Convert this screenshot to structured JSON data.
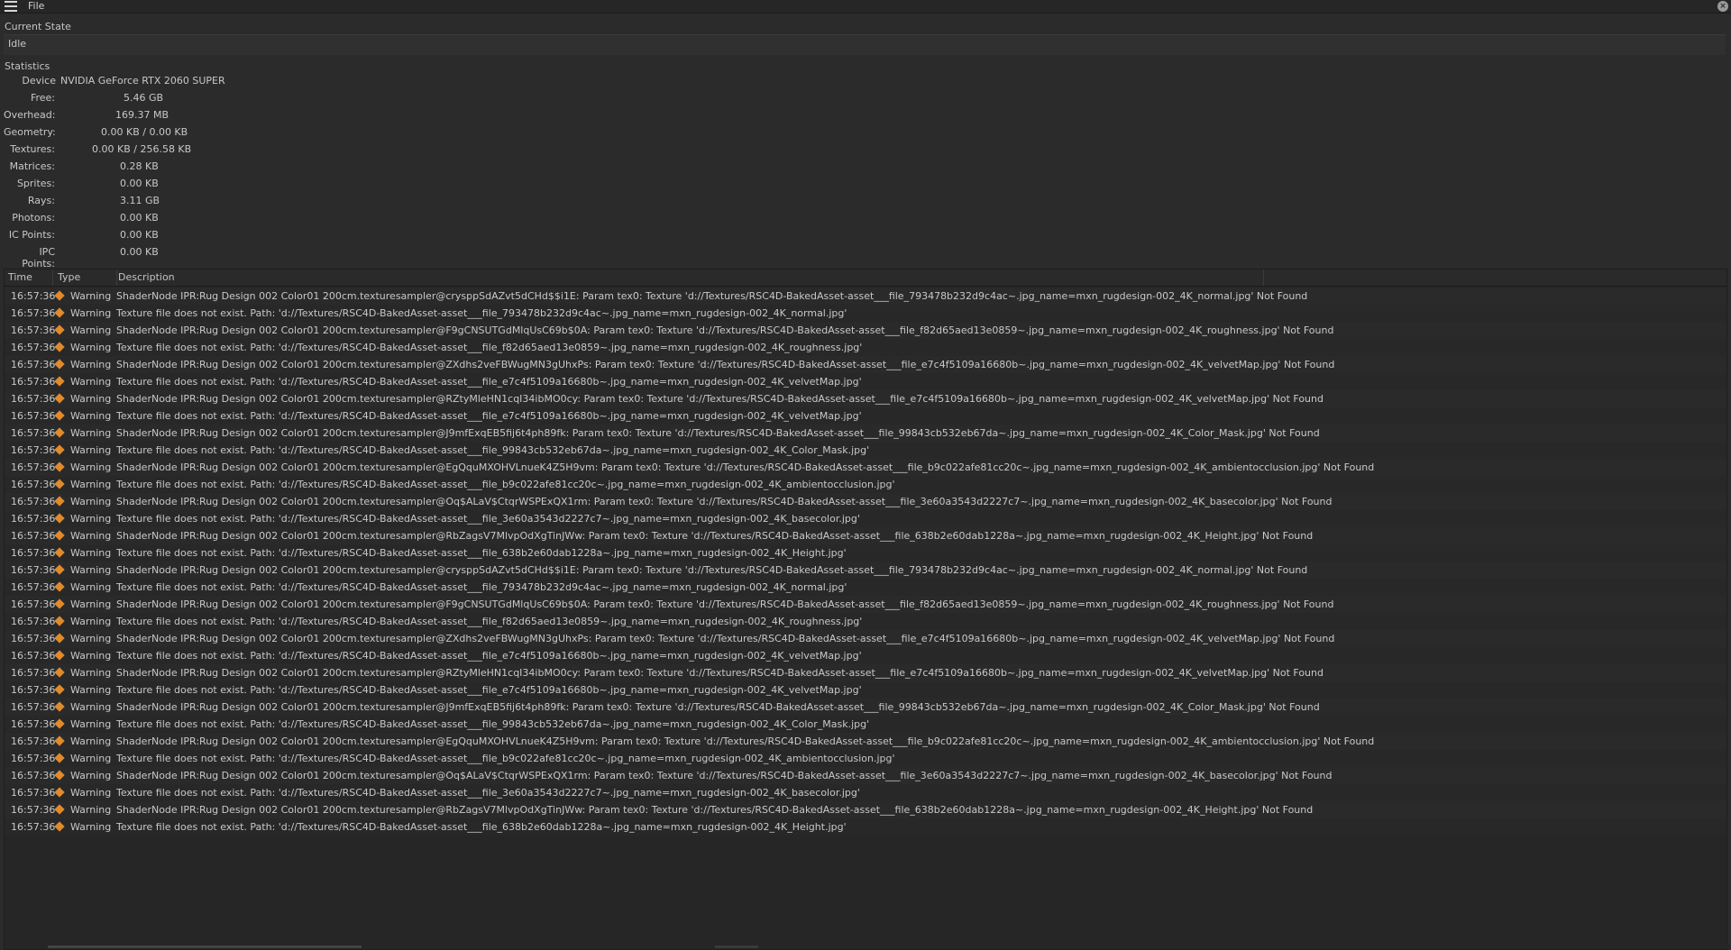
{
  "menu": {
    "file_label": "File"
  },
  "current_state": {
    "title": "Current State",
    "value": "Idle"
  },
  "statistics": {
    "title": "Statistics",
    "device_label": "Device",
    "device_value": "NVIDIA GeForce RTX 2060 SUPER",
    "rows": [
      {
        "label": "Free:",
        "value": "5.46 GB"
      },
      {
        "label": "Overhead:",
        "value": "169.37 MB"
      },
      {
        "label": "Geometry:",
        "value": "0.00 KB / 0.00 KB"
      },
      {
        "label": "Textures:",
        "value": "0.00 KB / 256.58 KB"
      },
      {
        "label": "Matrices:",
        "value": "0.28 KB"
      },
      {
        "label": "Sprites:",
        "value": "0.00 KB"
      },
      {
        "label": "Rays:",
        "value": "3.11 GB"
      },
      {
        "label": "Photons:",
        "value": "0.00 KB"
      },
      {
        "label": "IC Points:",
        "value": "0.00 KB"
      },
      {
        "label": "IPC Points:",
        "value": "0.00 KB"
      }
    ]
  },
  "log": {
    "columns": {
      "time": "Time",
      "type": "Type",
      "description": "Description"
    },
    "warning_color": "#e08a2c",
    "rows": [
      {
        "time": "16:57:36",
        "type": "Warning",
        "description": "ShaderNode IPR:Rug Design 002 Color01 200cm.texturesampler@crysppSdAZvt5dCHd$$i1E: Param tex0: Texture 'd://Textures/RSC4D-BakedAsset-asset___file_793478b232d9c4ac~.jpg_name=mxn_rugdesign-002_4K_normal.jpg' Not Found"
      },
      {
        "time": "16:57:36",
        "type": "Warning",
        "description": "Texture file does not exist. Path: 'd://Textures/RSC4D-BakedAsset-asset___file_793478b232d9c4ac~.jpg_name=mxn_rugdesign-002_4K_normal.jpg'"
      },
      {
        "time": "16:57:36",
        "type": "Warning",
        "description": "ShaderNode IPR:Rug Design 002 Color01 200cm.texturesampler@F9gCNSUTGdMlqUsC69b$0A: Param tex0: Texture 'd://Textures/RSC4D-BakedAsset-asset___file_f82d65aed13e0859~.jpg_name=mxn_rugdesign-002_4K_roughness.jpg' Not Found"
      },
      {
        "time": "16:57:36",
        "type": "Warning",
        "description": "Texture file does not exist. Path: 'd://Textures/RSC4D-BakedAsset-asset___file_f82d65aed13e0859~.jpg_name=mxn_rugdesign-002_4K_roughness.jpg'"
      },
      {
        "time": "16:57:36",
        "type": "Warning",
        "description": "ShaderNode IPR:Rug Design 002 Color01 200cm.texturesampler@ZXdhs2veFBWugMN3gUhxPs: Param tex0: Texture 'd://Textures/RSC4D-BakedAsset-asset___file_e7c4f5109a16680b~.jpg_name=mxn_rugdesign-002_4K_velvetMap.jpg' Not Found"
      },
      {
        "time": "16:57:36",
        "type": "Warning",
        "description": "Texture file does not exist. Path: 'd://Textures/RSC4D-BakedAsset-asset___file_e7c4f5109a16680b~.jpg_name=mxn_rugdesign-002_4K_velvetMap.jpg'"
      },
      {
        "time": "16:57:36",
        "type": "Warning",
        "description": "ShaderNode IPR:Rug Design 002 Color01 200cm.texturesampler@RZtyMleHN1cqI34ibMO0cy: Param tex0: Texture 'd://Textures/RSC4D-BakedAsset-asset___file_e7c4f5109a16680b~.jpg_name=mxn_rugdesign-002_4K_velvetMap.jpg' Not Found"
      },
      {
        "time": "16:57:36",
        "type": "Warning",
        "description": "Texture file does not exist. Path: 'd://Textures/RSC4D-BakedAsset-asset___file_e7c4f5109a16680b~.jpg_name=mxn_rugdesign-002_4K_velvetMap.jpg'"
      },
      {
        "time": "16:57:36",
        "type": "Warning",
        "description": "ShaderNode IPR:Rug Design 002 Color01 200cm.texturesampler@J9mfExqEB5fij6t4ph89fk: Param tex0: Texture 'd://Textures/RSC4D-BakedAsset-asset___file_99843cb532eb67da~.jpg_name=mxn_rugdesign-002_4K_Color_Mask.jpg' Not Found"
      },
      {
        "time": "16:57:36",
        "type": "Warning",
        "description": "Texture file does not exist. Path: 'd://Textures/RSC4D-BakedAsset-asset___file_99843cb532eb67da~.jpg_name=mxn_rugdesign-002_4K_Color_Mask.jpg'"
      },
      {
        "time": "16:57:36",
        "type": "Warning",
        "description": "ShaderNode IPR:Rug Design 002 Color01 200cm.texturesampler@EgQquMXOHVLnueK4Z5H9vm: Param tex0: Texture 'd://Textures/RSC4D-BakedAsset-asset___file_b9c022afe81cc20c~.jpg_name=mxn_rugdesign-002_4K_ambientocclusion.jpg' Not Found"
      },
      {
        "time": "16:57:36",
        "type": "Warning",
        "description": "Texture file does not exist. Path: 'd://Textures/RSC4D-BakedAsset-asset___file_b9c022afe81cc20c~.jpg_name=mxn_rugdesign-002_4K_ambientocclusion.jpg'"
      },
      {
        "time": "16:57:36",
        "type": "Warning",
        "description": "ShaderNode IPR:Rug Design 002 Color01 200cm.texturesampler@Oq$ALaV$CtqrWSPExQX1rm: Param tex0: Texture 'd://Textures/RSC4D-BakedAsset-asset___file_3e60a3543d2227c7~.jpg_name=mxn_rugdesign-002_4K_basecolor.jpg' Not Found"
      },
      {
        "time": "16:57:36",
        "type": "Warning",
        "description": "Texture file does not exist. Path: 'd://Textures/RSC4D-BakedAsset-asset___file_3e60a3543d2227c7~.jpg_name=mxn_rugdesign-002_4K_basecolor.jpg'"
      },
      {
        "time": "16:57:36",
        "type": "Warning",
        "description": "ShaderNode IPR:Rug Design 002 Color01 200cm.texturesampler@RbZagsV7MlvpOdXgTinJWw: Param tex0: Texture 'd://Textures/RSC4D-BakedAsset-asset___file_638b2e60dab1228a~.jpg_name=mxn_rugdesign-002_4K_Height.jpg' Not Found"
      },
      {
        "time": "16:57:36",
        "type": "Warning",
        "description": "Texture file does not exist. Path: 'd://Textures/RSC4D-BakedAsset-asset___file_638b2e60dab1228a~.jpg_name=mxn_rugdesign-002_4K_Height.jpg'"
      },
      {
        "time": "16:57:36",
        "type": "Warning",
        "description": "ShaderNode IPR:Rug Design 002 Color01 200cm.texturesampler@crysppSdAZvt5dCHd$$i1E: Param tex0: Texture 'd://Textures/RSC4D-BakedAsset-asset___file_793478b232d9c4ac~.jpg_name=mxn_rugdesign-002_4K_normal.jpg' Not Found"
      },
      {
        "time": "16:57:36",
        "type": "Warning",
        "description": "Texture file does not exist. Path: 'd://Textures/RSC4D-BakedAsset-asset___file_793478b232d9c4ac~.jpg_name=mxn_rugdesign-002_4K_normal.jpg'"
      },
      {
        "time": "16:57:36",
        "type": "Warning",
        "description": "ShaderNode IPR:Rug Design 002 Color01 200cm.texturesampler@F9gCNSUTGdMlqUsC69b$0A: Param tex0: Texture 'd://Textures/RSC4D-BakedAsset-asset___file_f82d65aed13e0859~.jpg_name=mxn_rugdesign-002_4K_roughness.jpg' Not Found"
      },
      {
        "time": "16:57:36",
        "type": "Warning",
        "description": "Texture file does not exist. Path: 'd://Textures/RSC4D-BakedAsset-asset___file_f82d65aed13e0859~.jpg_name=mxn_rugdesign-002_4K_roughness.jpg'"
      },
      {
        "time": "16:57:36",
        "type": "Warning",
        "description": "ShaderNode IPR:Rug Design 002 Color01 200cm.texturesampler@ZXdhs2veFBWugMN3gUhxPs: Param tex0: Texture 'd://Textures/RSC4D-BakedAsset-asset___file_e7c4f5109a16680b~.jpg_name=mxn_rugdesign-002_4K_velvetMap.jpg' Not Found"
      },
      {
        "time": "16:57:36",
        "type": "Warning",
        "description": "Texture file does not exist. Path: 'd://Textures/RSC4D-BakedAsset-asset___file_e7c4f5109a16680b~.jpg_name=mxn_rugdesign-002_4K_velvetMap.jpg'"
      },
      {
        "time": "16:57:36",
        "type": "Warning",
        "description": "ShaderNode IPR:Rug Design 002 Color01 200cm.texturesampler@RZtyMleHN1cqI34ibMO0cy: Param tex0: Texture 'd://Textures/RSC4D-BakedAsset-asset___file_e7c4f5109a16680b~.jpg_name=mxn_rugdesign-002_4K_velvetMap.jpg' Not Found"
      },
      {
        "time": "16:57:36",
        "type": "Warning",
        "description": "Texture file does not exist. Path: 'd://Textures/RSC4D-BakedAsset-asset___file_e7c4f5109a16680b~.jpg_name=mxn_rugdesign-002_4K_velvetMap.jpg'"
      },
      {
        "time": "16:57:36",
        "type": "Warning",
        "description": "ShaderNode IPR:Rug Design 002 Color01 200cm.texturesampler@J9mfExqEB5fij6t4ph89fk: Param tex0: Texture 'd://Textures/RSC4D-BakedAsset-asset___file_99843cb532eb67da~.jpg_name=mxn_rugdesign-002_4K_Color_Mask.jpg' Not Found"
      },
      {
        "time": "16:57:36",
        "type": "Warning",
        "description": "Texture file does not exist. Path: 'd://Textures/RSC4D-BakedAsset-asset___file_99843cb532eb67da~.jpg_name=mxn_rugdesign-002_4K_Color_Mask.jpg'"
      },
      {
        "time": "16:57:36",
        "type": "Warning",
        "description": "ShaderNode IPR:Rug Design 002 Color01 200cm.texturesampler@EgQquMXOHVLnueK4Z5H9vm: Param tex0: Texture 'd://Textures/RSC4D-BakedAsset-asset___file_b9c022afe81cc20c~.jpg_name=mxn_rugdesign-002_4K_ambientocclusion.jpg' Not Found"
      },
      {
        "time": "16:57:36",
        "type": "Warning",
        "description": "Texture file does not exist. Path: 'd://Textures/RSC4D-BakedAsset-asset___file_b9c022afe81cc20c~.jpg_name=mxn_rugdesign-002_4K_ambientocclusion.jpg'"
      },
      {
        "time": "16:57:36",
        "type": "Warning",
        "description": "ShaderNode IPR:Rug Design 002 Color01 200cm.texturesampler@Oq$ALaV$CtqrWSPExQX1rm: Param tex0: Texture 'd://Textures/RSC4D-BakedAsset-asset___file_3e60a3543d2227c7~.jpg_name=mxn_rugdesign-002_4K_basecolor.jpg' Not Found"
      },
      {
        "time": "16:57:36",
        "type": "Warning",
        "description": "Texture file does not exist. Path: 'd://Textures/RSC4D-BakedAsset-asset___file_3e60a3543d2227c7~.jpg_name=mxn_rugdesign-002_4K_basecolor.jpg'"
      },
      {
        "time": "16:57:36",
        "type": "Warning",
        "description": "ShaderNode IPR:Rug Design 002 Color01 200cm.texturesampler@RbZagsV7MlvpOdXgTinJWw: Param tex0: Texture 'd://Textures/RSC4D-BakedAsset-asset___file_638b2e60dab1228a~.jpg_name=mxn_rugdesign-002_4K_Height.jpg' Not Found"
      },
      {
        "time": "16:57:36",
        "type": "Warning",
        "description": "Texture file does not exist. Path: 'd://Textures/RSC4D-BakedAsset-asset___file_638b2e60dab1228a~.jpg_name=mxn_rugdesign-002_4K_Height.jpg'"
      }
    ]
  }
}
